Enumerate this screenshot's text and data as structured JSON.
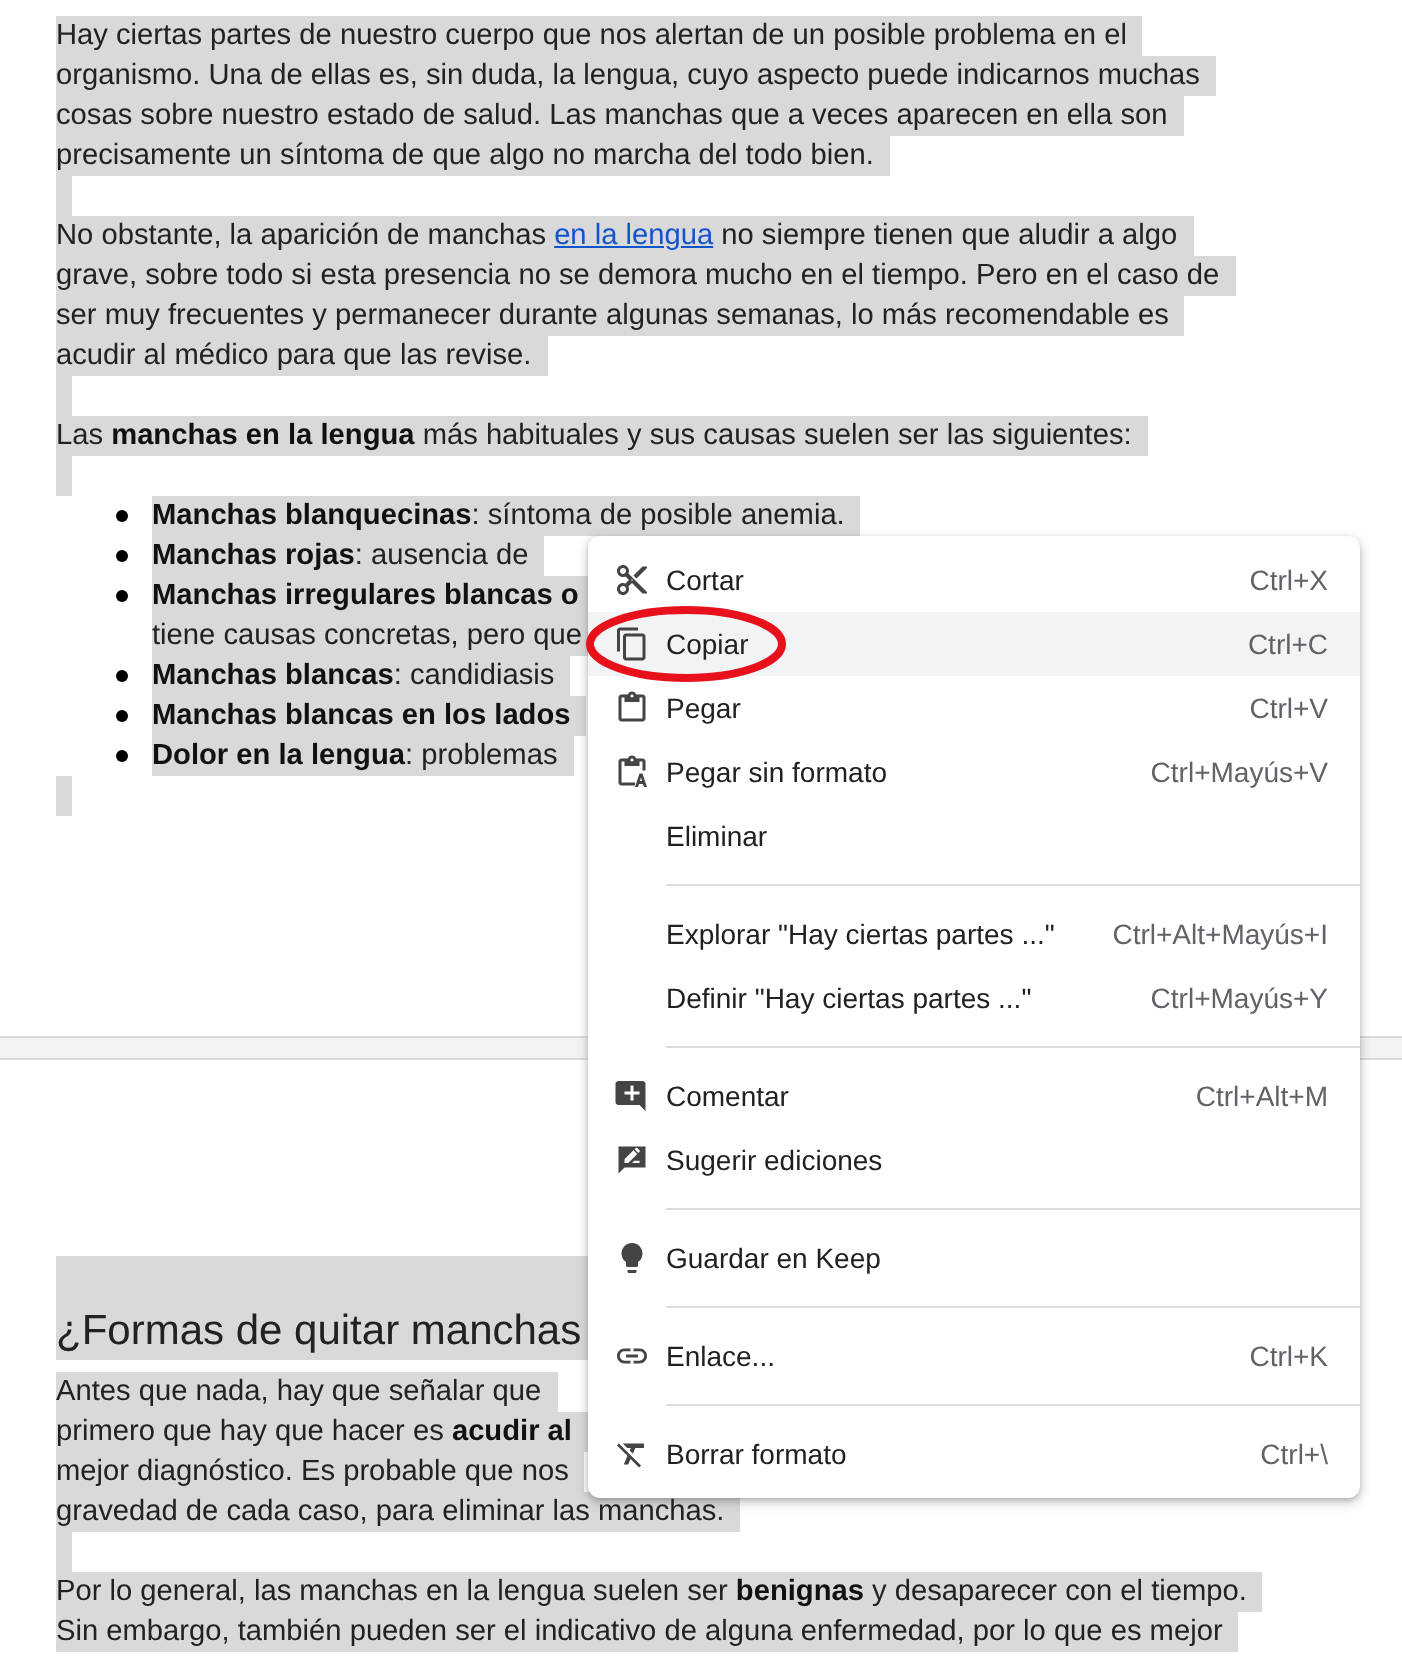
{
  "document": {
    "pages": [
      {
        "blocks": [
          {
            "kind": "paragraph",
            "lines": [
              "Hay ciertas partes de nuestro cuerpo que nos alertan de un posible problema en el",
              "organismo. Una de ellas es, sin duda, la lengua, cuyo aspecto puede indicarnos muchas",
              "cosas sobre nuestro estado de salud. Las manchas que a veces aparecen en ella son",
              "precisamente un síntoma de que algo no marcha del todo bien."
            ]
          },
          {
            "kind": "blank"
          },
          {
            "kind": "paragraph",
            "lines": [
              {
                "before": "No obstante, la aparición de manchas ",
                "link": "en la lengua",
                "after": " no siempre tienen que aludir a algo"
              },
              "grave, sobre todo si esta presencia no se demora mucho en el tiempo. Pero en el caso de",
              "ser muy frecuentes y permanecer durante algunas semanas, lo más recomendable es",
              "acudir al médico para que las revise."
            ]
          },
          {
            "kind": "blank"
          },
          {
            "kind": "paragraph",
            "lines": [
              "Las **manchas en la lengua** más habituales y sus causas suelen ser las siguientes:"
            ]
          },
          {
            "kind": "blank"
          },
          {
            "kind": "list",
            "items": [
              {
                "lines": [
                  "**Manchas blanquecinas**: síntoma de posible anemia."
                ]
              },
              {
                "lines": [
                  "**Manchas rojas**: ausencia de"
                ]
              },
              {
                "lines": [
                  "**Manchas irregulares blancas o**",
                  "tiene causas concretas, pero que"
                ]
              },
              {
                "lines": [
                  "**Manchas blancas**: candidiasis"
                ]
              },
              {
                "lines": [
                  "**Manchas blancas en los lados**"
                ]
              },
              {
                "lines": [
                  "**Dolor en la lengua**: problemas"
                ]
              }
            ]
          },
          {
            "kind": "blank"
          }
        ]
      },
      {
        "blocks": [
          {
            "kind": "heading",
            "text": "¿Formas de quitar manchas"
          },
          {
            "kind": "paragraph",
            "lines": [
              "Antes que nada, hay que señalar que",
              "primero que hay que hacer es **acudir al**",
              "mejor diagnóstico. Es probable que nos",
              "gravedad de cada caso, para eliminar las manchas."
            ]
          },
          {
            "kind": "blank"
          },
          {
            "kind": "paragraph",
            "lines": [
              "Por lo general, las manchas en la lengua suelen ser **benignas** y desaparecer con el tiempo.",
              "Sin embargo, también pueden ser el indicativo de alguna enfermedad, por lo que es mejor"
            ]
          }
        ]
      }
    ]
  },
  "context_menu": {
    "items": [
      {
        "kind": "item",
        "label": "Cortar",
        "shortcut": "Ctrl+X",
        "selected": false,
        "circled": false
      },
      {
        "kind": "item",
        "label": "Copiar",
        "shortcut": "Ctrl+C",
        "selected": true,
        "circled": true
      },
      {
        "kind": "item",
        "label": "Pegar",
        "shortcut": "Ctrl+V",
        "selected": false,
        "circled": false
      },
      {
        "kind": "item",
        "label": "Pegar sin formato",
        "shortcut": "Ctrl+Mayús+V",
        "selected": false,
        "circled": false
      },
      {
        "kind": "item",
        "label": "Eliminar",
        "selected": false,
        "circled": false
      },
      {
        "kind": "separator"
      },
      {
        "kind": "item",
        "label": "Explorar \"Hay ciertas partes ...\"",
        "shortcut": "Ctrl+Alt+Mayús+I",
        "selected": false,
        "circled": false
      },
      {
        "kind": "item",
        "label": "Definir \"Hay ciertas partes ...\"",
        "shortcut": "Ctrl+Mayús+Y",
        "selected": false,
        "circled": false
      },
      {
        "kind": "separator"
      },
      {
        "kind": "item",
        "label": "Comentar",
        "shortcut": "Ctrl+Alt+M",
        "selected": false,
        "circled": false
      },
      {
        "kind": "item",
        "label": "Sugerir ediciones",
        "selected": false,
        "circled": false
      },
      {
        "kind": "separator"
      },
      {
        "kind": "item",
        "label": "Guardar en Keep",
        "selected": false,
        "circled": false
      },
      {
        "kind": "separator"
      },
      {
        "kind": "item",
        "label": "Enlace...",
        "shortcut": "Ctrl+K",
        "selected": false,
        "circled": false
      },
      {
        "kind": "separator"
      },
      {
        "kind": "item",
        "label": "Borrar formato",
        "shortcut": "Ctrl+\\",
        "selected": false,
        "circled": false
      }
    ]
  }
}
